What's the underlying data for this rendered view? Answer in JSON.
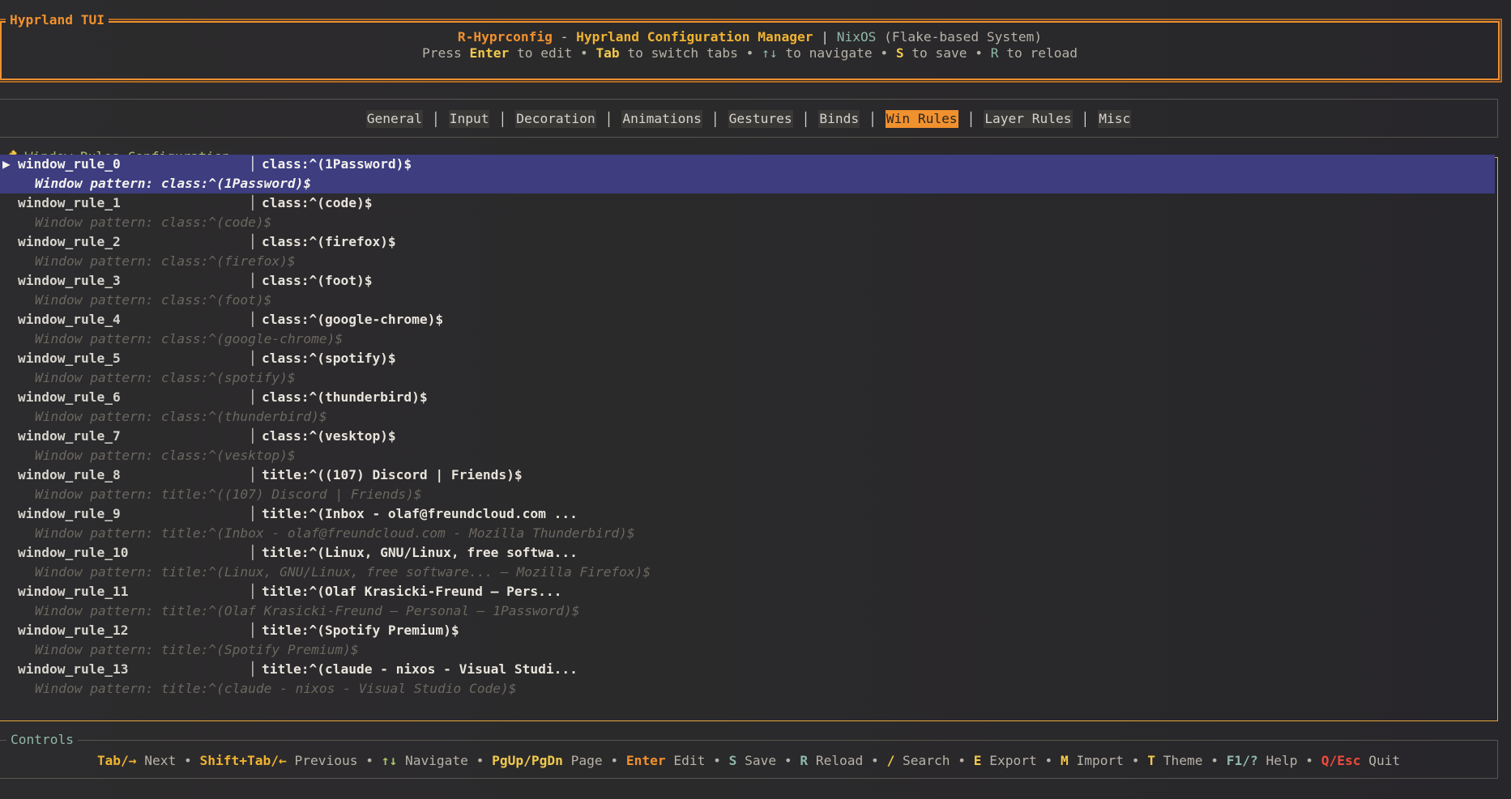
{
  "header": {
    "title": "Hyprland TUI",
    "line1": {
      "app": "R-Hyprconfig",
      "dash": " - ",
      "subtitle": "Hyprland Configuration Manager",
      "pipe": " | ",
      "os": "NixOS",
      "os_note": " (Flake-based System)"
    },
    "line2": {
      "press": "Press ",
      "enter": "Enter",
      "to_edit": " to edit • ",
      "tab": "Tab",
      "to_switch": " to switch tabs • ",
      "arrows": "↑↓",
      "to_nav": " to navigate • ",
      "s": "S",
      "to_save": " to save • ",
      "r": "R",
      "to_reload": " to reload"
    }
  },
  "tabs": [
    {
      "label": "General",
      "active": false
    },
    {
      "label": "Input",
      "active": false
    },
    {
      "label": "Decoration",
      "active": false
    },
    {
      "label": "Animations",
      "active": false
    },
    {
      "label": "Gestures",
      "active": false
    },
    {
      "label": "Binds",
      "active": false
    },
    {
      "label": "Win Rules",
      "active": true
    },
    {
      "label": "Layer Rules",
      "active": false
    },
    {
      "label": "Misc",
      "active": false
    }
  ],
  "panel": {
    "icon": "ruler-icon",
    "title": " Window Rules Configuration",
    "pointer": "▶",
    "bar": "│"
  },
  "rules": [
    {
      "name": "window_rule_0",
      "value": "class:^(1Password)$",
      "detail": "Window pattern: class:^(1Password)$",
      "selected": true
    },
    {
      "name": "window_rule_1",
      "value": "class:^(code)$",
      "detail": "Window pattern: class:^(code)$"
    },
    {
      "name": "window_rule_2",
      "value": "class:^(firefox)$",
      "detail": "Window pattern: class:^(firefox)$"
    },
    {
      "name": "window_rule_3",
      "value": "class:^(foot)$",
      "detail": "Window pattern: class:^(foot)$"
    },
    {
      "name": "window_rule_4",
      "value": "class:^(google-chrome)$",
      "detail": "Window pattern: class:^(google-chrome)$"
    },
    {
      "name": "window_rule_5",
      "value": "class:^(spotify)$",
      "detail": "Window pattern: class:^(spotify)$"
    },
    {
      "name": "window_rule_6",
      "value": "class:^(thunderbird)$",
      "detail": "Window pattern: class:^(thunderbird)$"
    },
    {
      "name": "window_rule_7",
      "value": "class:^(vesktop)$",
      "detail": "Window pattern: class:^(vesktop)$"
    },
    {
      "name": "window_rule_8",
      "value": "title:^((107) Discord | Friends)$",
      "detail": "Window pattern: title:^((107) Discord | Friends)$"
    },
    {
      "name": "window_rule_9",
      "value": "title:^(Inbox - olaf@freundcloud.com ...",
      "detail": "Window pattern: title:^(Inbox - olaf@freundcloud.com - Mozilla Thunderbird)$"
    },
    {
      "name": "window_rule_10",
      "value": "title:^(Linux, GNU/Linux, free softwa...",
      "detail": "Window pattern: title:^(Linux, GNU/Linux, free software... — Mozilla Firefox)$"
    },
    {
      "name": "window_rule_11",
      "value": "title:^(Olaf Krasicki-Freund — Pers...",
      "detail": "Window pattern: title:^(Olaf Krasicki-Freund — Personal — 1Password)$"
    },
    {
      "name": "window_rule_12",
      "value": "title:^(Spotify Premium)$",
      "detail": "Window pattern: title:^(Spotify Premium)$"
    },
    {
      "name": "window_rule_13",
      "value": "title:^(claude - nixos - Visual Studi...",
      "detail": "Window pattern: title:^(claude - nixos - Visual Studio Code)$"
    }
  ],
  "controls": {
    "title": "Controls",
    "items": [
      {
        "key": "Tab/→",
        "label": " Next",
        "color": "#f0b330"
      },
      {
        "key": "Shift+Tab/←",
        "label": " Previous",
        "color": "#f0b330"
      },
      {
        "key": "↑↓",
        "label": " Navigate",
        "color": "#a8c46a"
      },
      {
        "key": "PgUp/PgDn",
        "label": " Page",
        "color": "#f2c94c"
      },
      {
        "key": "Enter",
        "label": " Edit",
        "color": "#f0912f"
      },
      {
        "key": "S",
        "label": " Save",
        "color": "#8fb8a8"
      },
      {
        "key": "R",
        "label": " Reload",
        "color": "#8fb8a8"
      },
      {
        "key": "/",
        "label": " Search",
        "color": "#f2c94c"
      },
      {
        "key": "E",
        "label": " Export",
        "color": "#f2c94c"
      },
      {
        "key": "M",
        "label": " Import",
        "color": "#f2c94c"
      },
      {
        "key": "T",
        "label": " Theme",
        "color": "#f2c94c"
      },
      {
        "key": "F1/?",
        "label": " Help",
        "color": "#8fb8a8"
      },
      {
        "key": "Q/Esc",
        "label": " Quit",
        "color": "#ef4b3c"
      }
    ],
    "separator": " • "
  },
  "colors": {
    "accent": "#f0912f",
    "selection": "#3d3d80",
    "panel_border": "#e8a83a"
  }
}
